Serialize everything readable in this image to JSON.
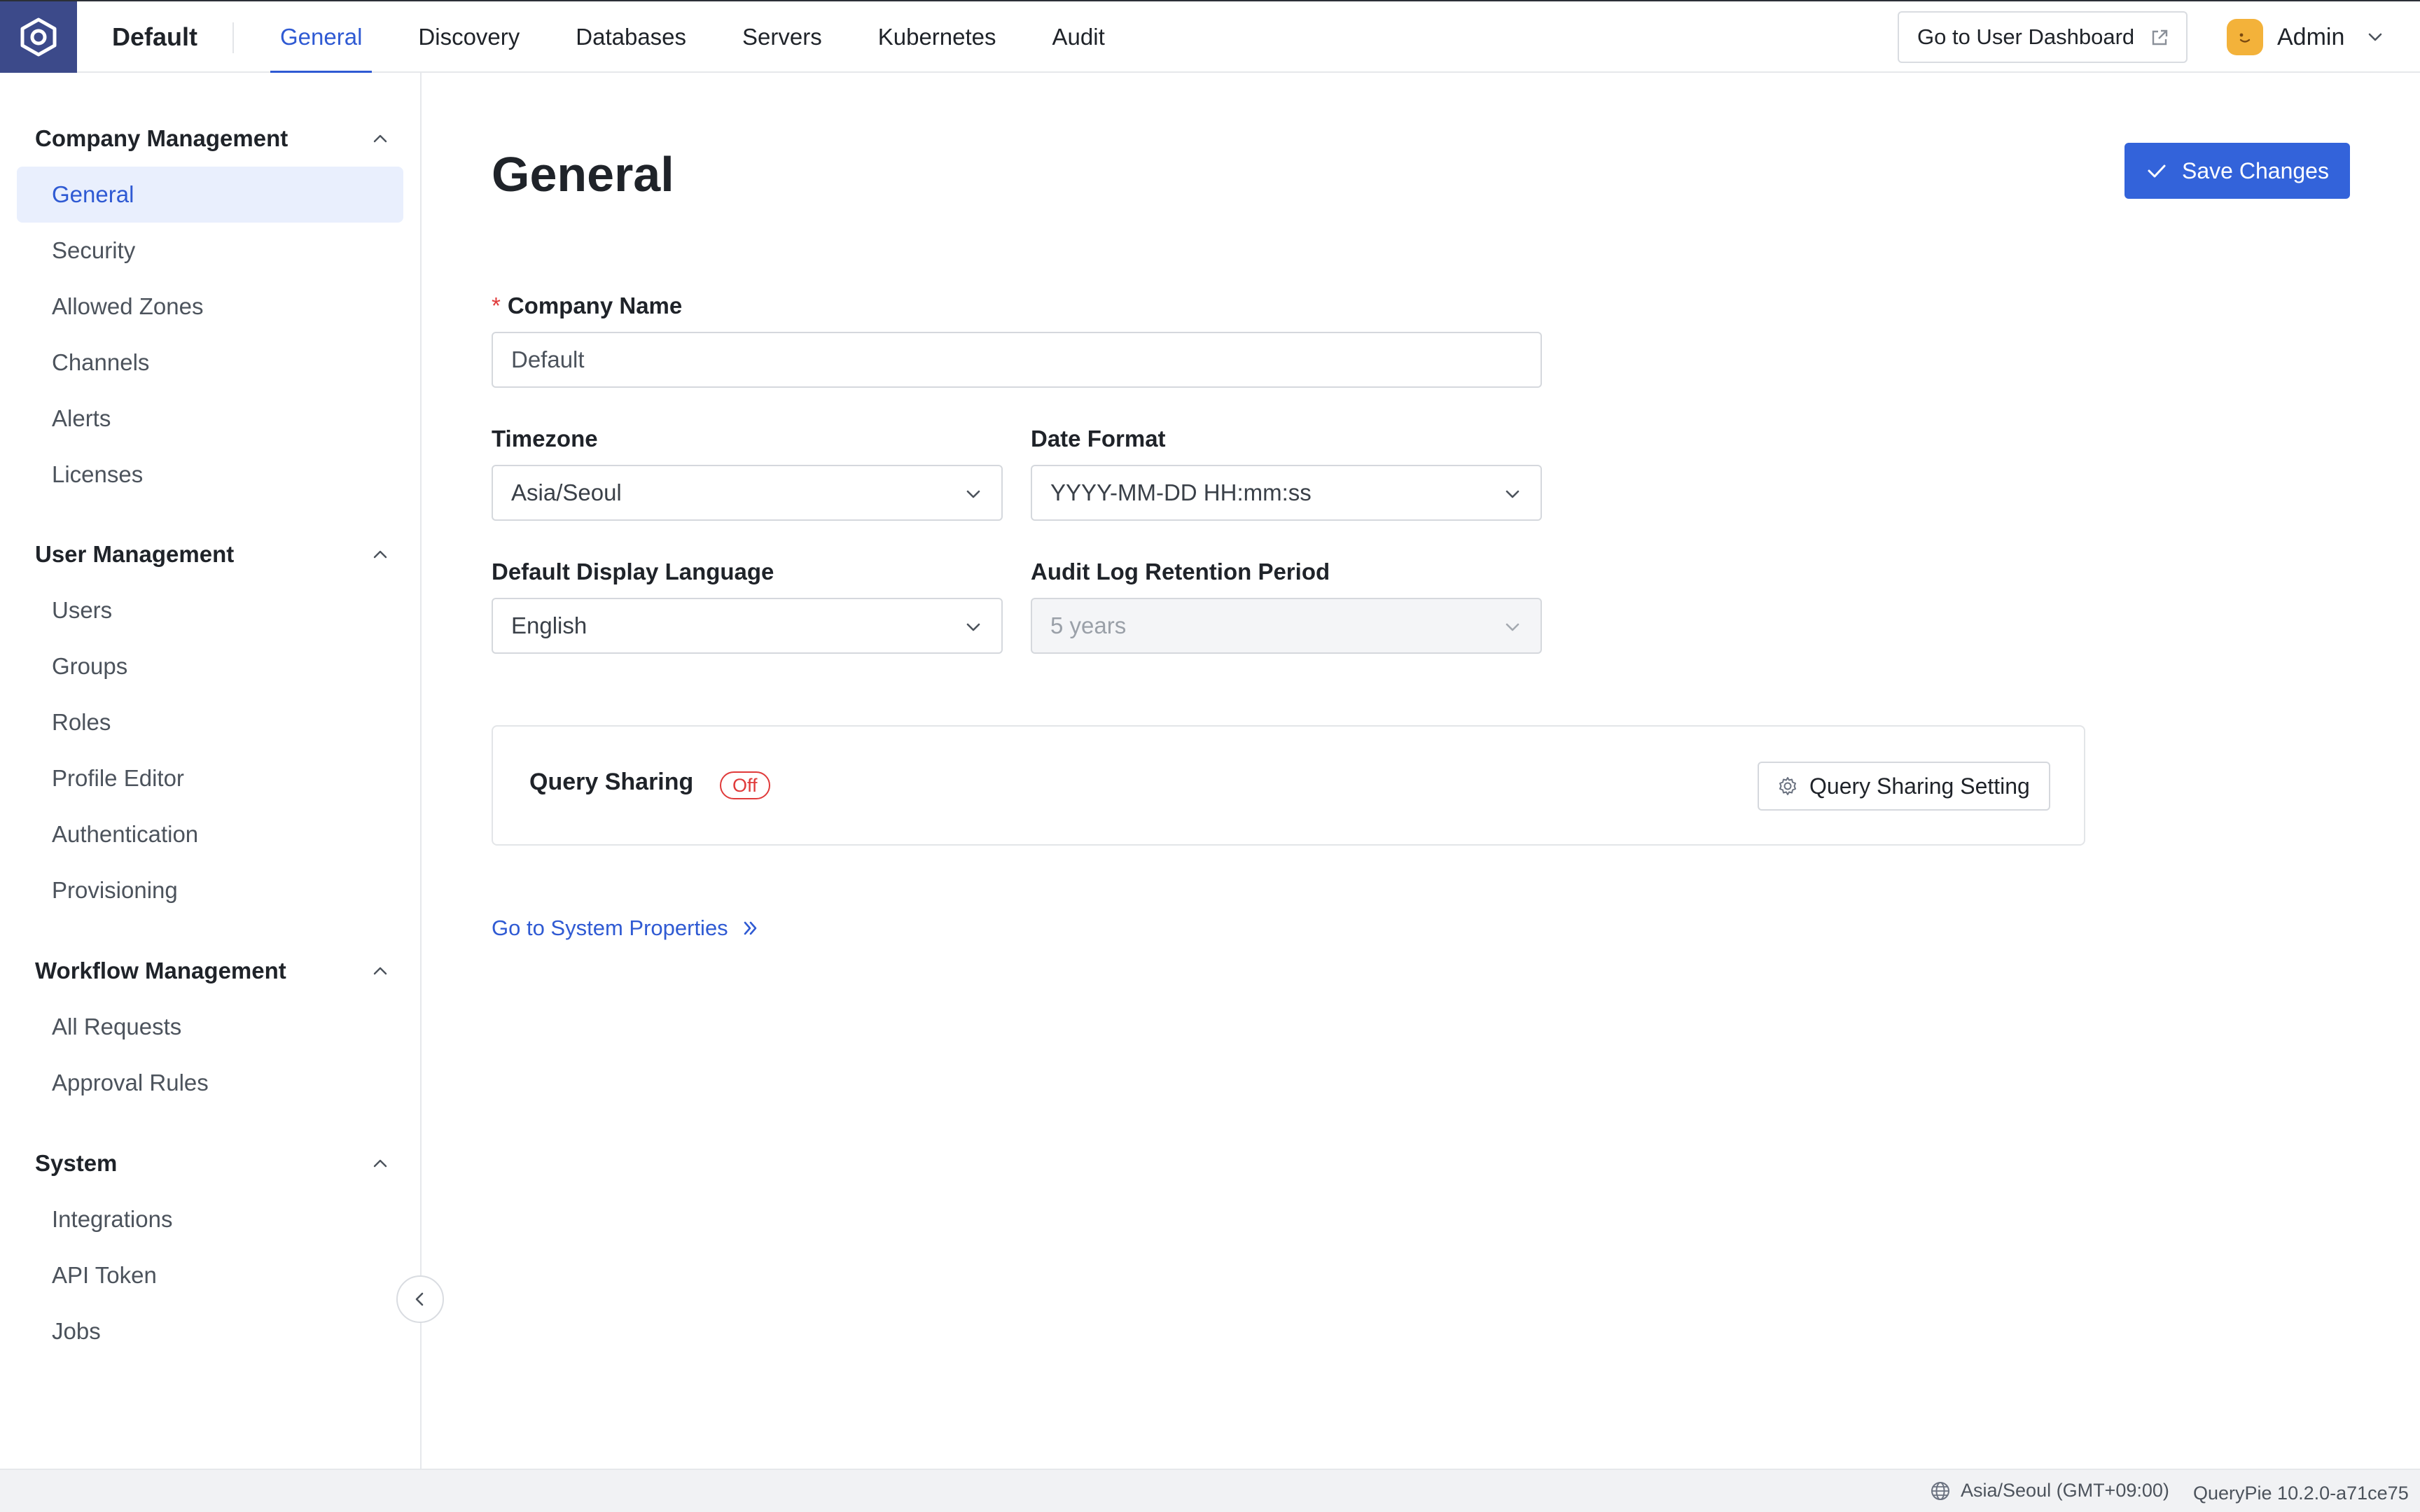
{
  "app": {
    "workspace": "Default"
  },
  "nav": {
    "tabs": [
      "General",
      "Discovery",
      "Databases",
      "Servers",
      "Kubernetes",
      "Audit"
    ],
    "active": "General"
  },
  "header": {
    "dashboard_button": "Go to User Dashboard",
    "user_name": "Admin"
  },
  "sidebar": {
    "sections": [
      {
        "title": "Company Management",
        "items": [
          "General",
          "Security",
          "Allowed Zones",
          "Channels",
          "Alerts",
          "Licenses"
        ]
      },
      {
        "title": "User Management",
        "items": [
          "Users",
          "Groups",
          "Roles",
          "Profile Editor",
          "Authentication",
          "Provisioning"
        ]
      },
      {
        "title": "Workflow Management",
        "items": [
          "All Requests",
          "Approval Rules"
        ]
      },
      {
        "title": "System",
        "items": [
          "Integrations",
          "API Token",
          "Jobs"
        ]
      }
    ],
    "active_item": "General"
  },
  "main": {
    "title": "General",
    "save_button": "Save Changes",
    "company_name": {
      "label": "Company Name",
      "required_mark": "*",
      "value": "Default"
    },
    "timezone": {
      "label": "Timezone",
      "value": "Asia/Seoul"
    },
    "date_format": {
      "label": "Date Format",
      "value": "YYYY-MM-DD HH:mm:ss"
    },
    "display_language": {
      "label": "Default Display Language",
      "value": "English"
    },
    "audit_retention": {
      "label": "Audit Log Retention Period",
      "value": "5 years",
      "disabled": true
    },
    "query_sharing": {
      "label": "Query Sharing",
      "status": "Off",
      "setting_button": "Query Sharing Setting"
    },
    "system_properties_link": "Go to System Properties"
  },
  "footer": {
    "timezone": "Asia/Seoul (GMT+09:00)",
    "version": "QueryPie 10.2.0-a71ce75"
  },
  "colors": {
    "accent": "#2f5ad3",
    "primary_button": "#3363da",
    "logo_bg": "#3c4a8a",
    "status_off": "#e03a3a"
  },
  "icons": {
    "logo": "querypie-logo-icon",
    "external": "external-link-icon",
    "user_menu": "chevron-down-icon",
    "section_toggle": "chevron-up-icon",
    "collapse": "chevron-left-icon",
    "save": "check-icon",
    "select": "chevron-down-icon",
    "setting": "gear-icon",
    "link": "double-chevron-right-icon",
    "timezone": "globe-icon"
  }
}
